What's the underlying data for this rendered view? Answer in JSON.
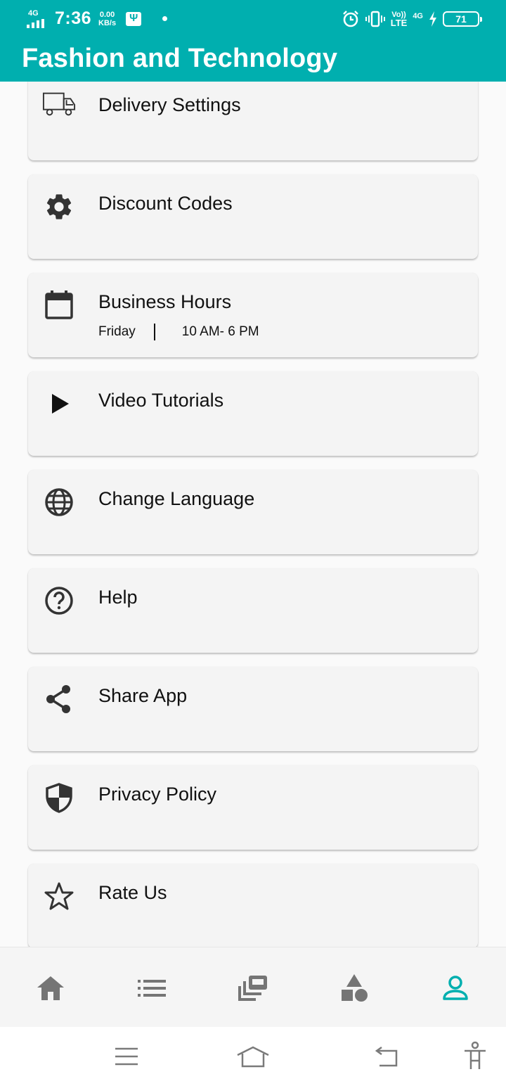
{
  "status_bar": {
    "network_label": "4G",
    "time": "7:36",
    "speed_value": "0.00",
    "speed_unit": "KB/s",
    "volte_top": "Vo))",
    "volte_bottom": "LTE",
    "network_type": "4G",
    "battery": "71"
  },
  "app_bar": {
    "title": "Fashion and Technology"
  },
  "menu": {
    "items": [
      {
        "label": "Delivery Settings",
        "icon": "truck-icon"
      },
      {
        "label": "Discount Codes",
        "icon": "gear-icon"
      },
      {
        "label": "Business Hours",
        "icon": "calendar-icon",
        "day": "Friday",
        "hours": "10 AM- 6 PM"
      },
      {
        "label": "Video Tutorials",
        "icon": "play-icon"
      },
      {
        "label": "Change Language",
        "icon": "globe-icon"
      },
      {
        "label": "Help",
        "icon": "help-icon"
      },
      {
        "label": "Share App",
        "icon": "share-icon"
      },
      {
        "label": "Privacy Policy",
        "icon": "shield-icon"
      },
      {
        "label": "Rate Us",
        "icon": "star-icon"
      }
    ]
  },
  "bottom_nav": {
    "items": [
      {
        "icon": "home-icon",
        "active": false
      },
      {
        "icon": "list-icon",
        "active": false
      },
      {
        "icon": "gallery-icon",
        "active": false
      },
      {
        "icon": "shapes-icon",
        "active": false
      },
      {
        "icon": "person-icon",
        "active": true
      }
    ],
    "active_color": "#00afaf",
    "inactive_color": "#757575"
  },
  "colors": {
    "primary": "#00afaf",
    "card_bg": "#f4f4f4",
    "icon": "#333333"
  }
}
